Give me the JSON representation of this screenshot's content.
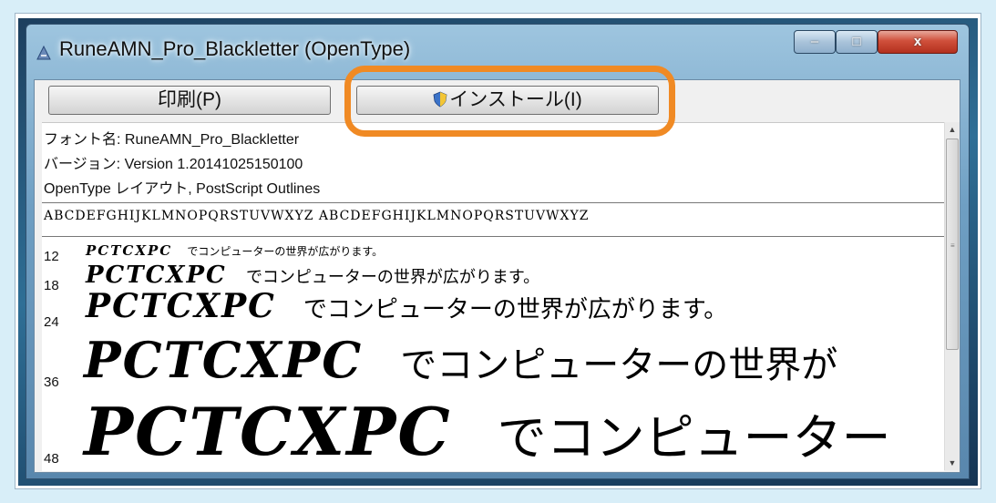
{
  "window": {
    "title": "RuneAMN_Pro_Blackletter (OpenType)",
    "controls": {
      "minimize": "–",
      "maximize": "□",
      "close": "x"
    }
  },
  "toolbar": {
    "print_label": "印刷(P)",
    "install_label": "インストール(I)"
  },
  "font_info": {
    "name_line": "フォント名: RuneAMN_Pro_Blackletter",
    "version_line": "バージョン: Version 1.20141025150100",
    "layout_line": "OpenType レイアウト, PostScript Outlines"
  },
  "charset_sample": "ABCDEFGHIJKLMNOPQRSTUVWXYZ  ABCDEFGHIJKLMNOPQRSTUVWXYZ",
  "samples": [
    {
      "size": "12",
      "latin": "PCTCXPC",
      "japanese": "でコンピューターの世界が広がります。"
    },
    {
      "size": "18",
      "latin": "PCTCXPC",
      "japanese": "でコンピューターの世界が広がります。"
    },
    {
      "size": "24",
      "latin": "PCTCXPC",
      "japanese": "でコンピューターの世界が広がります。"
    },
    {
      "size": "36",
      "latin": "PCTCXPC",
      "japanese": "でコンピューターの世界が"
    },
    {
      "size": "48",
      "latin": "PCTCXPC",
      "japanese": "でコンピューター"
    }
  ],
  "colors": {
    "highlight": "#f08a24",
    "page_background": "#d8eef8",
    "close_button": "#c84530"
  },
  "icons": [
    "app-font-icon",
    "uac-shield-icon",
    "scroll-up-icon",
    "scroll-down-icon"
  ]
}
